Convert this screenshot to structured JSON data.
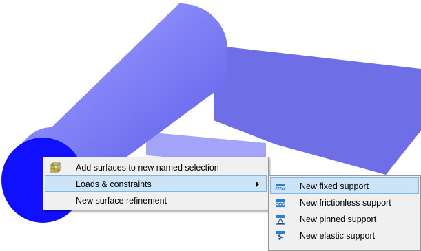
{
  "colors": {
    "body_side": "#7070f0",
    "body_end_cap": "#1010ff",
    "plate_top": "#6e6ee6",
    "cylinder_highlight": "#b0b0ff",
    "menu_background": "#f0f0f0",
    "menu_highlight": "#cce4f7",
    "icon_blue": "#2f7fd1"
  },
  "context_menu": {
    "items": [
      {
        "label": "Add surfaces to new named selection",
        "icon": "named-selection-icon"
      },
      {
        "label": "Loads & constraints",
        "icon": "",
        "has_submenu": true,
        "highlighted": true
      },
      {
        "label": "New surface refinement",
        "icon": ""
      }
    ]
  },
  "submenu": {
    "items": [
      {
        "label": "New fixed support",
        "icon": "fixed-support-icon",
        "highlighted": true
      },
      {
        "label": "New frictionless support",
        "icon": "frictionless-support-icon"
      },
      {
        "label": "New pinned support",
        "icon": "pinned-support-icon"
      },
      {
        "label": "New elastic support",
        "icon": "elastic-support-icon"
      }
    ]
  }
}
